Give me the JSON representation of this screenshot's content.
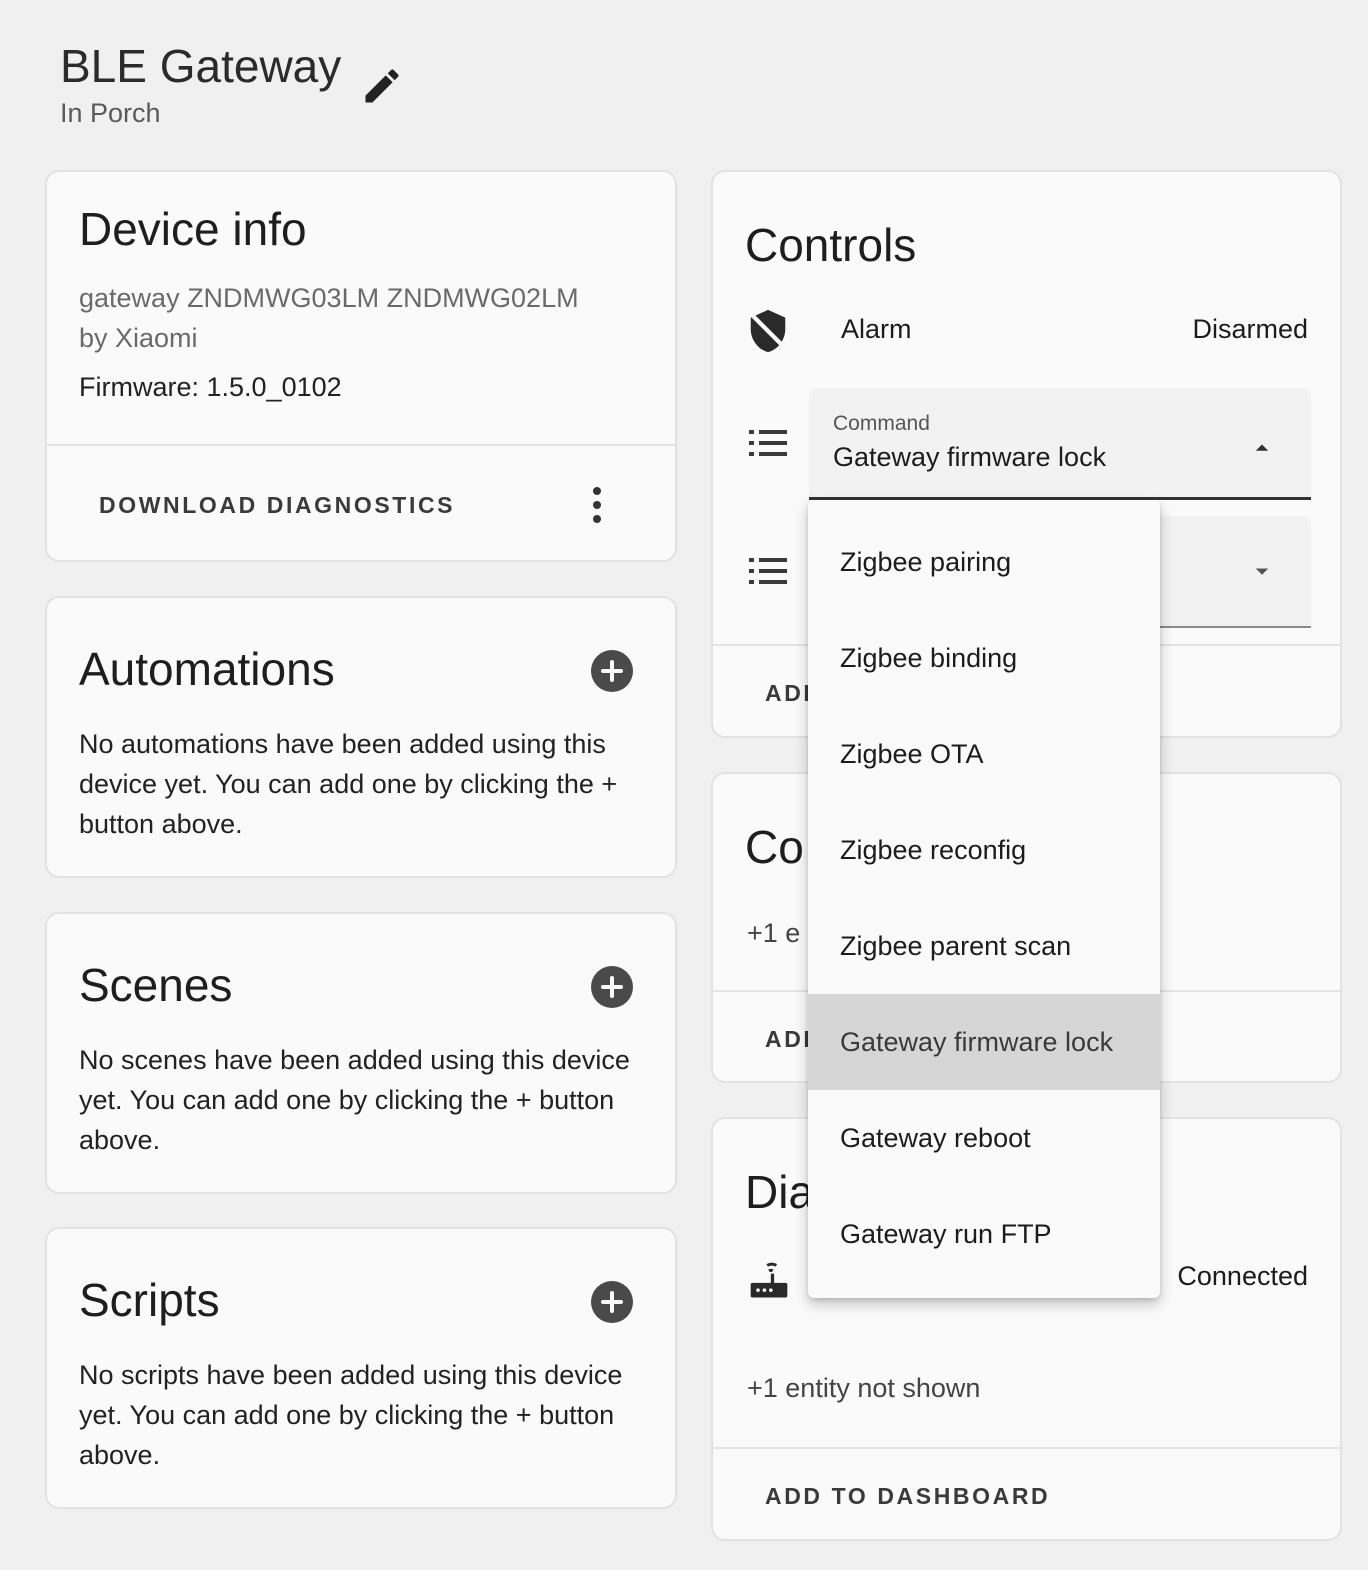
{
  "header": {
    "title": "BLE Gateway",
    "subtitle": "In Porch",
    "edit_icon": "pencil-icon"
  },
  "device_info": {
    "title": "Device info",
    "model_line1": "gateway ZNDMWG03LM ZNDMWG02LM",
    "model_line2": "by Xiaomi",
    "firmware": "Firmware: 1.5.0_0102",
    "download_label": "DOWNLOAD DIAGNOSTICS"
  },
  "automations": {
    "title": "Automations",
    "body": "No automations have been added using this device yet. You can add one by clicking the + button above."
  },
  "scenes": {
    "title": "Scenes",
    "body": "No scenes have been added using this device yet. You can add one by clicking the + button above."
  },
  "scripts": {
    "title": "Scripts",
    "body": "No scripts have been added using this device yet. You can add one by clicking the + button above."
  },
  "controls": {
    "title": "Controls",
    "alarm_label": "Alarm",
    "alarm_state": "Disarmed",
    "command_label": "Command",
    "command_value": "Gateway firmware lock",
    "add_label_partial": "ADD"
  },
  "config": {
    "title_partial": "Co",
    "entities_partial": "+1 e",
    "add_label_partial": "ADD"
  },
  "diagnostic": {
    "title_partial": "Dia",
    "state": "Connected",
    "entities_not_shown": "+1 entity not shown",
    "add_label": "ADD TO DASHBOARD"
  },
  "menu": {
    "items": [
      "Zigbee pairing",
      "Zigbee binding",
      "Zigbee OTA",
      "Zigbee reconfig",
      "Zigbee parent scan",
      "Gateway firmware lock",
      "Gateway reboot",
      "Gateway run FTP"
    ],
    "selected": "Gateway firmware lock"
  },
  "colors": {
    "background": "#f0f0f0",
    "card": "#fafafa",
    "selected_item": "#d6d6d6",
    "field_underline": "#333333"
  }
}
